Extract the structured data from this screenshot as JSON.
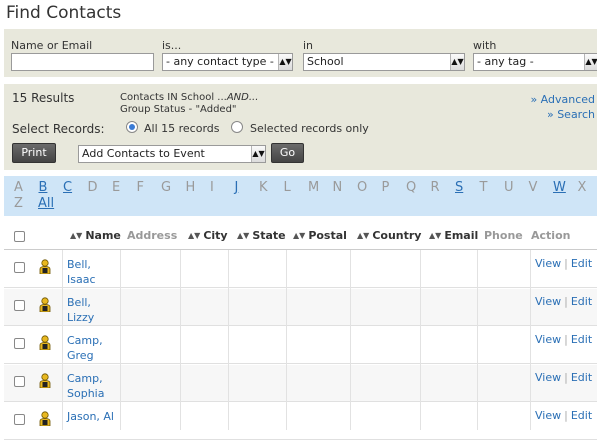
{
  "page": {
    "title": "Find Contacts"
  },
  "search": {
    "name_label": "Name or Email",
    "name_value": "",
    "is_label": "is...",
    "contact_type": "- any contact type -",
    "in_label": "in",
    "in_value": "School",
    "with_label": "with",
    "tag_value": "- any tag -"
  },
  "results": {
    "count": "15 Results",
    "criteria_line1": "Contacts IN School ...",
    "criteria_and": "AND...",
    "criteria_line2": "Group Status - \"Added\"",
    "advanced_link": "» Advanced",
    "search_link": "» Search",
    "select_label": "Select Records:",
    "all_label": "All 15 records",
    "selected_label": "Selected records only",
    "print_label": "Print",
    "action_value": "Add Contacts to Event",
    "go_label": "Go"
  },
  "alphabet": {
    "letters": [
      {
        "l": "A",
        "on": false
      },
      {
        "l": "B",
        "on": true
      },
      {
        "l": "C",
        "on": true
      },
      {
        "l": "D",
        "on": false
      },
      {
        "l": "E",
        "on": false
      },
      {
        "l": "F",
        "on": false
      },
      {
        "l": "G",
        "on": false
      },
      {
        "l": "H",
        "on": false
      },
      {
        "l": "I",
        "on": false
      },
      {
        "l": "J",
        "on": true
      },
      {
        "l": "K",
        "on": false
      },
      {
        "l": "L",
        "on": false
      },
      {
        "l": "M",
        "on": false
      },
      {
        "l": "N",
        "on": false
      },
      {
        "l": "O",
        "on": false
      },
      {
        "l": "P",
        "on": false
      },
      {
        "l": "Q",
        "on": false
      },
      {
        "l": "R",
        "on": false
      },
      {
        "l": "S",
        "on": true
      },
      {
        "l": "T",
        "on": false
      },
      {
        "l": "U",
        "on": false
      },
      {
        "l": "V",
        "on": false
      },
      {
        "l": "W",
        "on": true
      },
      {
        "l": "X",
        "on": false
      }
    ],
    "second_row": [
      {
        "l": "Z",
        "on": false
      },
      {
        "l": "All",
        "on": true
      }
    ]
  },
  "table": {
    "columns": [
      "Name",
      "Address",
      "City",
      "State",
      "Postal",
      "Country",
      "Email",
      "Phone",
      "Action"
    ],
    "rows": [
      {
        "first": "Bell,",
        "last": "Isaac"
      },
      {
        "first": "Bell,",
        "last": "Lizzy"
      },
      {
        "first": "Camp,",
        "last": "Greg"
      },
      {
        "first": "Camp,",
        "last": "Sophia"
      },
      {
        "first": "Jason, Al",
        "last": ""
      }
    ],
    "view_label": "View",
    "edit_label": "Edit"
  }
}
